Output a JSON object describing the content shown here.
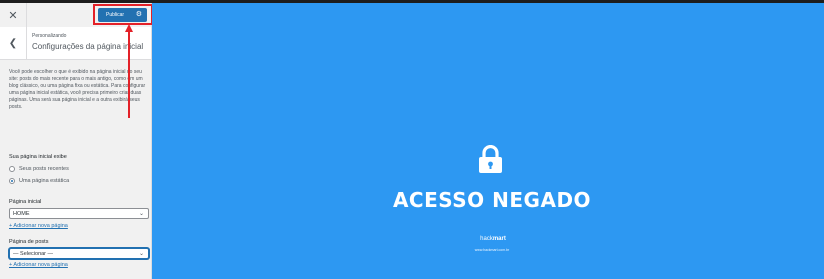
{
  "header": {
    "close_glyph": "✕",
    "publish_label": "Publicar"
  },
  "section": {
    "breadcrumb": "Personalizando",
    "title": "Configurações da página inicial"
  },
  "description": "Você pode escolher o que é exibido na página inicial do seu site: posts do mais recente para o mais antigo, como em um blog clássico, ou uma página fixa ou estática. Para configurar uma página inicial estática, você precisa primeiro criar duas páginas. Uma será sua página inicial e a outra exibirá seus posts.",
  "homepage_display": {
    "label": "Sua página inicial exibe",
    "options": [
      {
        "label": "Seus posts recentes",
        "checked": false
      },
      {
        "label": "Uma página estática",
        "checked": true
      }
    ]
  },
  "homepage": {
    "label": "Página inicial",
    "selected": "HOME",
    "add_link": "+ Adicionar nova página"
  },
  "posts_page": {
    "label": "Página de posts",
    "selected": "— Selecionar —",
    "add_link": "+ Adicionar nova página"
  },
  "preview": {
    "heading": "ACESSO NEGADO",
    "brand_prefix": "hack",
    "brand_suffix": "mart",
    "brand_url": "www.hackmart.com.br"
  },
  "colors": {
    "preview_bg": "#2d98f2",
    "accent": "#2271b1",
    "annotation": "#e32128"
  },
  "icons": [
    "close-icon",
    "gear-icon",
    "chevron-left-icon",
    "chevron-down-icon",
    "lock-icon"
  ]
}
